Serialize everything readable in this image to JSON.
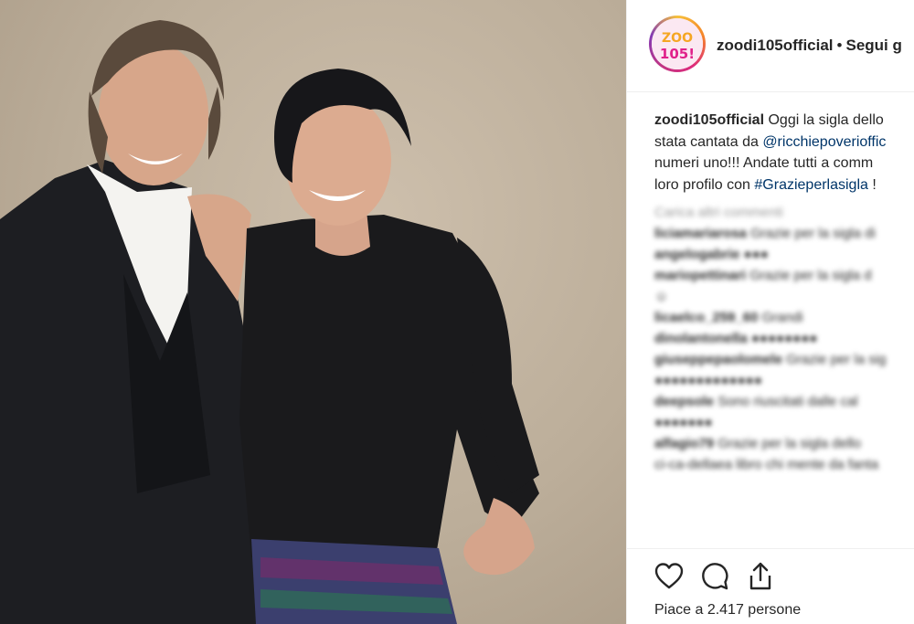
{
  "post": {
    "username": "zoodi105official",
    "follow_prefix": "•",
    "follow_label": "Segui g",
    "avatar_text_top": "ZOO",
    "avatar_text_bottom": "105!"
  },
  "caption": {
    "username": "zoodi105official",
    "line1_text": " Oggi la sigla dello",
    "line2_text": "stata cantata da ",
    "line2_mention": "@ricchiepoverioffic",
    "line3_text": "numeri uno!!! Andate tutti a comm",
    "line4_text": "loro profilo con ",
    "line4_hashtag": "#Grazieperlasigla",
    "line4_tail": " !"
  },
  "comments": {
    "load_more": "Carica altri commenti",
    "items": [
      {
        "user": "liciamariarosa",
        "text": "Grazie per la sigla di"
      },
      {
        "user": "angelogabrie",
        "text": "●●●"
      },
      {
        "user": "mariopettinari",
        "text": "Grazie per la sigla d"
      },
      {
        "user": "",
        "text": "☺"
      },
      {
        "user": "licaelco_259_60",
        "text": "Grandi"
      },
      {
        "user": "dinolantonella",
        "text": "●●●●●●●●"
      },
      {
        "user": "giuseppepaolomele",
        "text": "Grazie per la sig"
      },
      {
        "user": "",
        "text": "●●●●●●●●●●●●●"
      },
      {
        "user": "deepsole",
        "text": "Sono riuscitati dalle cal"
      },
      {
        "user": "",
        "text": "●●●●●●●"
      },
      {
        "user": "alfagio79",
        "text": "Grazie per la sigla dello"
      },
      {
        "user": "",
        "text": "ci-ca-dellaea libro chi mente da fanta"
      }
    ]
  },
  "actions": {
    "like_icon": "heart-icon",
    "comment_icon": "comment-icon",
    "share_icon": "share-icon"
  },
  "likes": {
    "text": "Piace a 2.417 persone"
  },
  "colors": {
    "link": "#003569",
    "text": "#262626",
    "divider": "#efefef",
    "photo_background": "#bcae9a"
  }
}
